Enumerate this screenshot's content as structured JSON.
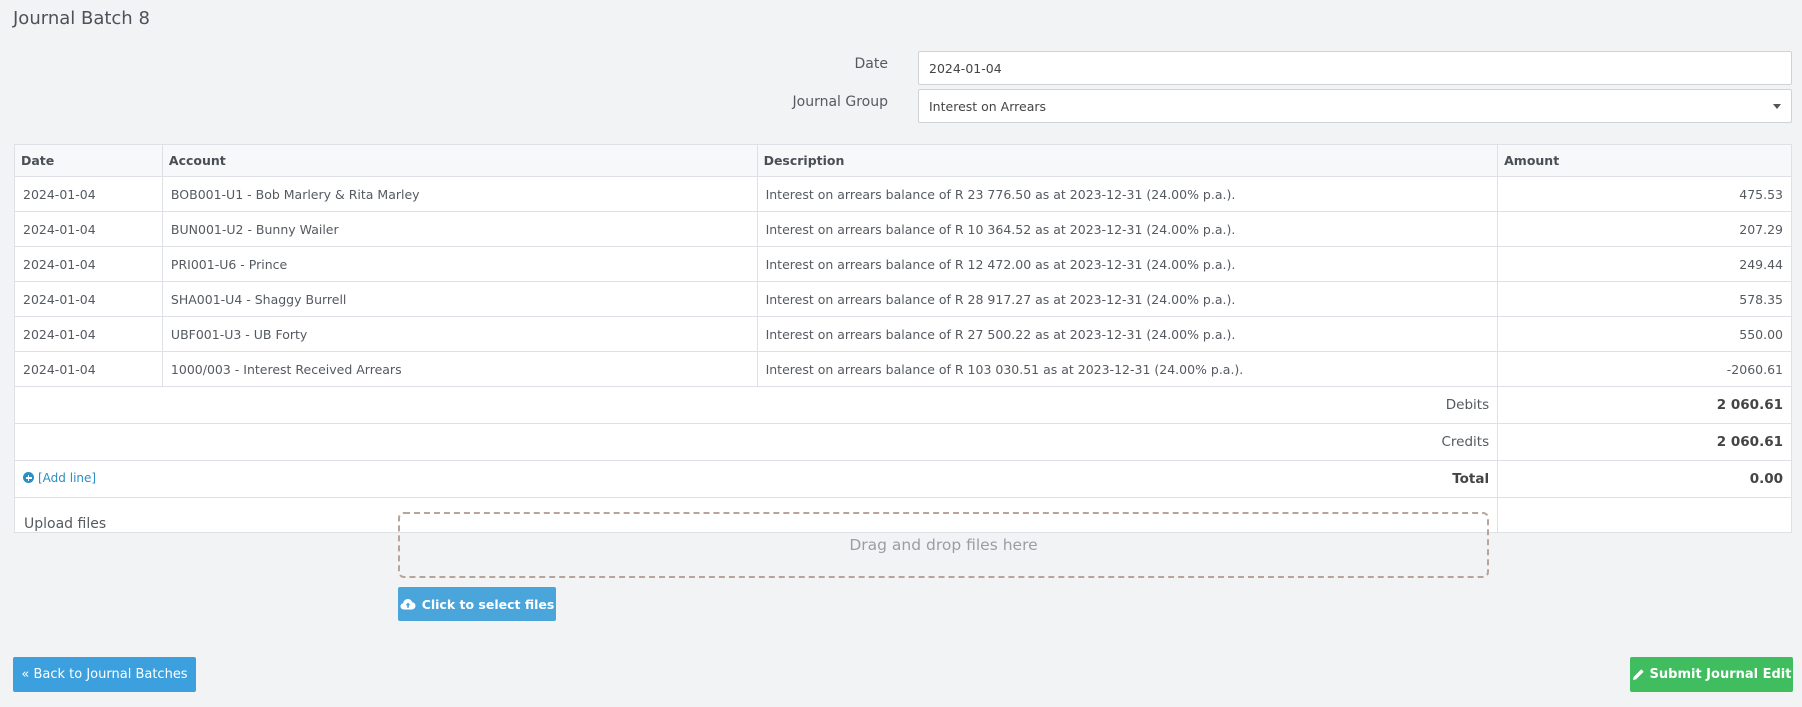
{
  "page": {
    "title": "Journal Batch 8"
  },
  "form": {
    "date_label": "Date",
    "date_value": "2024-01-04",
    "group_label": "Journal Group",
    "group_value": "Interest on Arrears"
  },
  "table": {
    "headers": {
      "date": "Date",
      "account": "Account",
      "description": "Description",
      "amount": "Amount"
    },
    "rows": [
      {
        "date": "2024-01-04",
        "account": "BOB001-U1 - Bob Marlery & Rita Marley",
        "description": "Interest on arrears balance of R 23 776.50 as at 2023-12-31 (24.00% p.a.).",
        "amount": "475.53"
      },
      {
        "date": "2024-01-04",
        "account": "BUN001-U2 - Bunny Wailer",
        "description": "Interest on arrears balance of R 10 364.52 as at 2023-12-31 (24.00% p.a.).",
        "amount": "207.29"
      },
      {
        "date": "2024-01-04",
        "account": "PRI001-U6 - Prince",
        "description": "Interest on arrears balance of R 12 472.00 as at 2023-12-31 (24.00% p.a.).",
        "amount": "249.44"
      },
      {
        "date": "2024-01-04",
        "account": "SHA001-U4 - Shaggy Burrell",
        "description": "Interest on arrears balance of R 28 917.27 as at 2023-12-31 (24.00% p.a.).",
        "amount": "578.35"
      },
      {
        "date": "2024-01-04",
        "account": "UBF001-U3 - UB Forty",
        "description": "Interest on arrears balance of R 27 500.22 as at 2023-12-31 (24.00% p.a.).",
        "amount": "550.00"
      },
      {
        "date": "2024-01-04",
        "account": "1000/003 - Interest Received Arrears",
        "description": "Interest on arrears balance of R 103 030.51 as at 2023-12-31 (24.00% p.a.).",
        "amount": "-2060.61"
      }
    ],
    "summary": {
      "debits_label": "Debits",
      "debits_value": "2 060.61",
      "credits_label": "Credits",
      "credits_value": "2 060.61",
      "total_label": "Total",
      "total_value": "0.00"
    },
    "add_line_label": "[Add line]"
  },
  "upload": {
    "label": "Upload files",
    "dropzone_text": "Drag and drop files here",
    "select_button": "Click to select files"
  },
  "actions": {
    "back_label": "« Back to Journal Batches",
    "submit_label": "Submit Journal Edit"
  },
  "colors": {
    "primary": "#3da0de",
    "success": "#3fbd5f",
    "link": "#2a8fc4"
  },
  "icons": {
    "add": "plus-circle-icon",
    "upload": "cloud-upload-icon",
    "submit": "pencil-icon"
  }
}
